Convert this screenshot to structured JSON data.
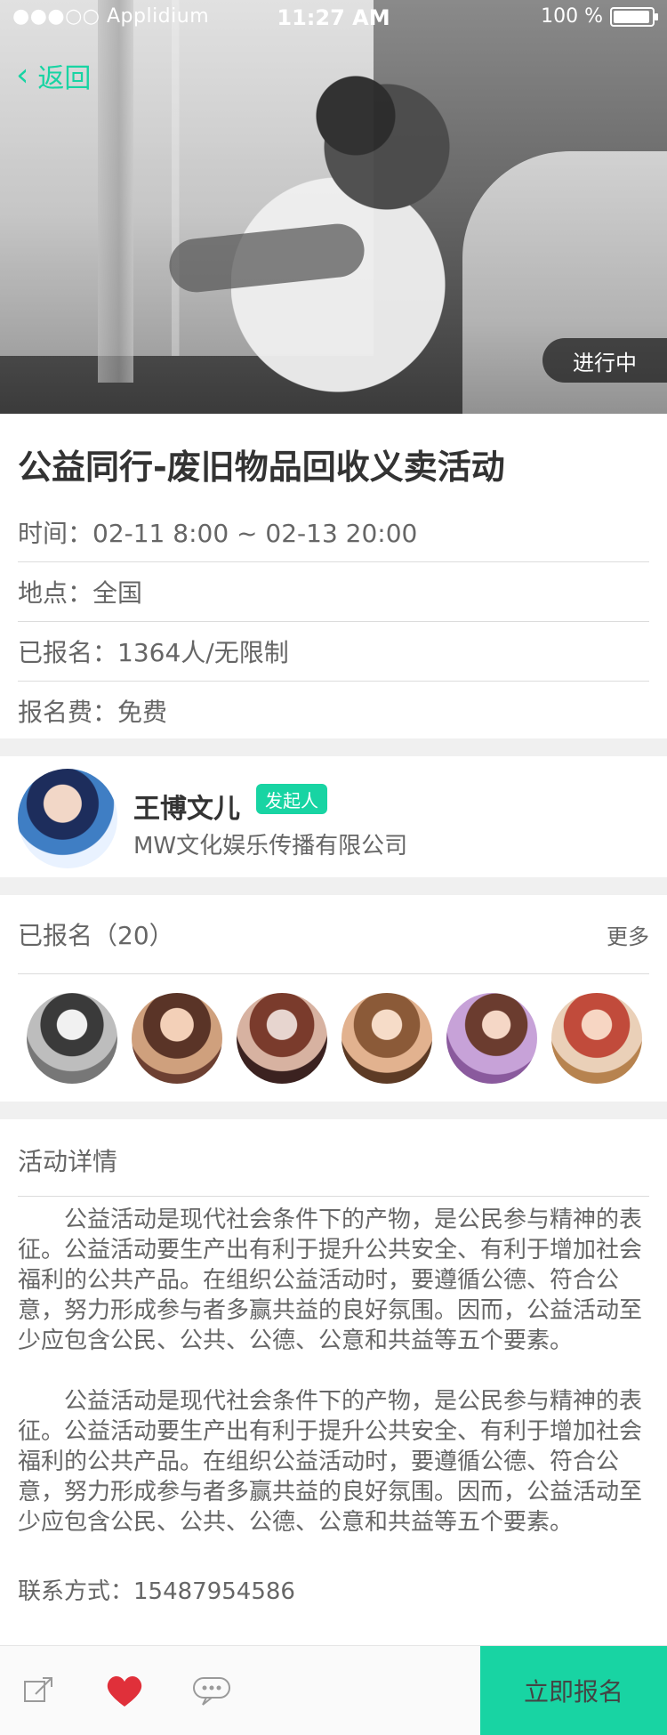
{
  "statusbar": {
    "carrier": "●●●○○ Applidium",
    "time": "11:27 AM",
    "battery": "100 %"
  },
  "nav": {
    "back_label": "返回"
  },
  "hero": {
    "status_pill": "进行中"
  },
  "event": {
    "title": "公益同行-废旧物品回收义卖活动",
    "time": "时间：02-11 8:00 ~ 02-13 20:00",
    "location": "地点：全国",
    "registered": "已报名：1364人/无限制",
    "fee": "报名费：免费"
  },
  "organizer": {
    "name": "王博文儿",
    "tag": "发起人",
    "company": "MW文化娱乐传播有限公司"
  },
  "registered_section": {
    "title": "已报名（20）",
    "more": "更多",
    "avatars": [
      "attendee-1",
      "attendee-2",
      "attendee-3",
      "attendee-4",
      "attendee-5",
      "attendee-6"
    ]
  },
  "details": {
    "title": "活动详情",
    "paragraph_1": "公益活动是现代社会条件下的产物，是公民参与精神的表征。公益活动要生产出有利于提升公共安全、有利于增加社会福利的公共产品。在组织公益活动时，要遵循公德、符合公意，努力形成参与者多赢共益的良好氛围。因而，公益活动至少应包含公民、公共、公德、公意和共益等五个要素。",
    "paragraph_2": "公益活动是现代社会条件下的产物，是公民参与精神的表征。公益活动要生产出有利于提升公共安全、有利于增加社会福利的公共产品。在组织公益活动时，要遵循公德、符合公意，努力形成参与者多赢共益的良好氛围。因而，公益活动至少应包含公民、公共、公德、公意和共益等五个要素。",
    "contact": "联系方式：15487954586"
  },
  "bottom_bar": {
    "share_icon": "share-icon",
    "like_icon": "heart-icon",
    "comment_icon": "comment-icon",
    "cta": "立即报名"
  },
  "colors": {
    "accent": "#18d4a3",
    "text_primary": "#333333",
    "text_secondary": "#666666",
    "separator": "#f0f0f0",
    "divider": "#dcdcdc",
    "heart": "#e0303a"
  }
}
